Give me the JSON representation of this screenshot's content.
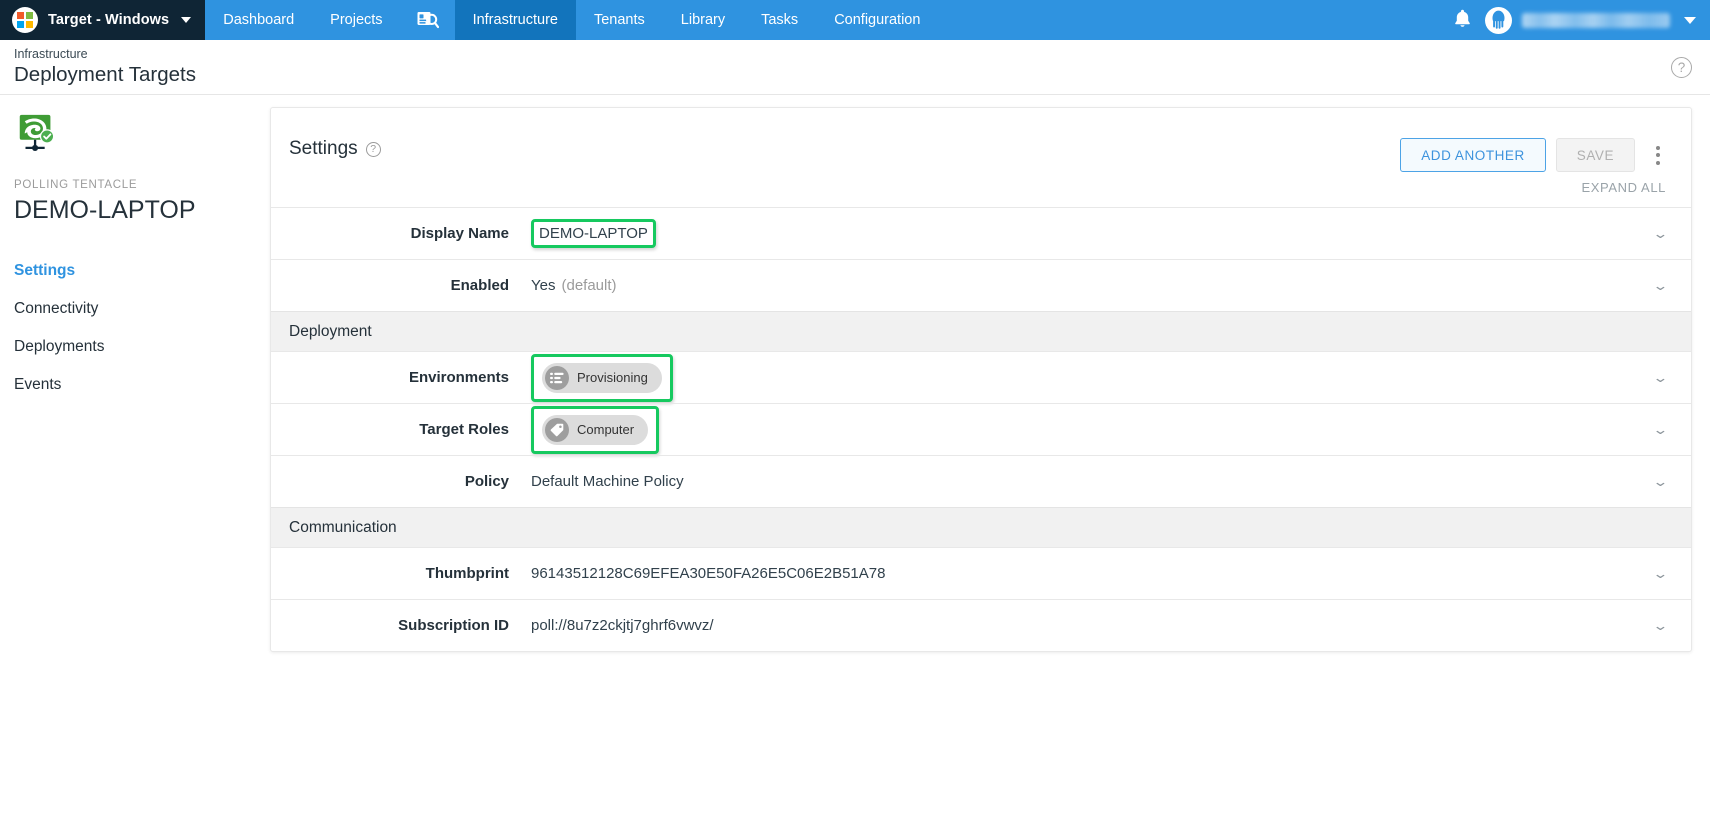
{
  "topnav": {
    "brand_label": "Target - Windows",
    "brand_icon": "microsoft-logo-icon",
    "brand_caret_icon": "caret-down-icon",
    "links": [
      {
        "label": "Dashboard",
        "active": false,
        "icon": null
      },
      {
        "label": "Projects",
        "active": false,
        "icon": null
      },
      {
        "label": "",
        "active": false,
        "icon": "search-document-icon"
      },
      {
        "label": "Infrastructure",
        "active": true,
        "icon": null
      },
      {
        "label": "Tenants",
        "active": false,
        "icon": null
      },
      {
        "label": "Library",
        "active": false,
        "icon": null
      },
      {
        "label": "Tasks",
        "active": false,
        "icon": null
      },
      {
        "label": "Configuration",
        "active": false,
        "icon": null
      }
    ],
    "notifications_icon": "bell-icon",
    "avatar_icon": "user-avatar-icon",
    "user_name": "",
    "user_caret_icon": "caret-down-icon",
    "colors": {
      "nav_bg": "#2f93e0",
      "nav_active_bg": "#1274bc",
      "brand_bg": "#0f2535"
    }
  },
  "pagehead": {
    "breadcrumb": "Infrastructure",
    "title": "Deployment Targets",
    "help_icon": "question-circle-icon",
    "help_label": "?"
  },
  "sidebar": {
    "status_icon": "tentacle-healthy-icon",
    "kicker": "POLLING TENTACLE",
    "title": "DEMO-LAPTOP",
    "items": [
      {
        "label": "Settings",
        "active": true
      },
      {
        "label": "Connectivity",
        "active": false
      },
      {
        "label": "Deployments",
        "active": false
      },
      {
        "label": "Events",
        "active": false
      }
    ],
    "active_color": "#2f93e0"
  },
  "card": {
    "title": "Settings",
    "title_help_icon": "question-circle-icon",
    "title_help_label": "?",
    "add_another_label": "ADD ANOTHER",
    "save_label": "SAVE",
    "overflow_icon": "kebab-menu-icon",
    "expand_all_label": "EXPAND ALL",
    "chevron_icon": "chevron-down-icon",
    "chevron_glyph": "⌄",
    "highlight_color": "#16c95f",
    "rows": [
      {
        "type": "field",
        "label": "Display Name",
        "value": "DEMO-LAPTOP",
        "highlighted": true,
        "kind": "text"
      },
      {
        "type": "field",
        "label": "Enabled",
        "value": "Yes",
        "suffix": "(default)",
        "highlighted": false,
        "kind": "text"
      },
      {
        "type": "section",
        "label": "Deployment"
      },
      {
        "type": "field",
        "label": "Environments",
        "value": "Provisioning",
        "highlighted": true,
        "kind": "chip",
        "chip_icon": "environment-list-icon"
      },
      {
        "type": "field",
        "label": "Target Roles",
        "value": "Computer",
        "highlighted": true,
        "kind": "chip",
        "chip_icon": "tag-icon"
      },
      {
        "type": "field",
        "label": "Policy",
        "value": "Default Machine Policy",
        "highlighted": false,
        "kind": "text"
      },
      {
        "type": "section",
        "label": "Communication"
      },
      {
        "type": "field",
        "label": "Thumbprint",
        "value": "96143512128C69EFEA30E50FA26E5C06E2B51A78",
        "highlighted": false,
        "kind": "text"
      },
      {
        "type": "field",
        "label": "Subscription ID",
        "value": "poll://8u7z2ckjtj7ghrf6vwvz/",
        "highlighted": false,
        "kind": "text"
      }
    ]
  }
}
